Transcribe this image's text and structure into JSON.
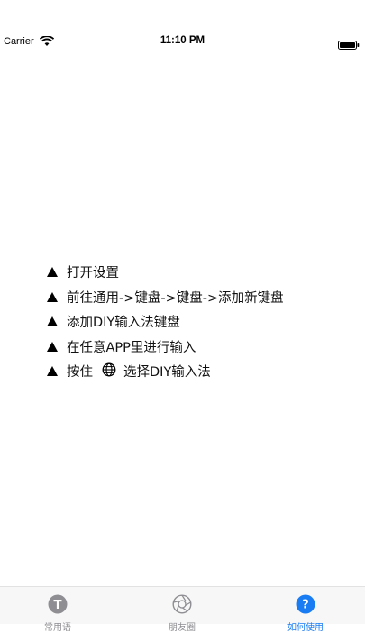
{
  "status_bar": {
    "carrier": "Carrier",
    "time": "11:10 PM",
    "wifi_icon": "wifi-icon",
    "battery_icon": "battery-icon"
  },
  "instructions": {
    "steps": [
      "打开设置",
      "前往通用->键盘->键盘->添加新键盘",
      "添加DIY输入法键盘",
      "在任意APP里进行输入"
    ],
    "last_step_before": "按住",
    "last_step_after": "选择DIY输入法",
    "globe_icon": "globe-icon"
  },
  "tab_bar": {
    "tabs": [
      {
        "label": "常用语",
        "icon": "text-icon",
        "active": false
      },
      {
        "label": "朋友圈",
        "icon": "aperture-icon",
        "active": false
      },
      {
        "label": "如何使用",
        "icon": "help-icon",
        "active": true
      }
    ],
    "active_color": "#1a7cf2",
    "inactive_color": "#8e8e93"
  }
}
